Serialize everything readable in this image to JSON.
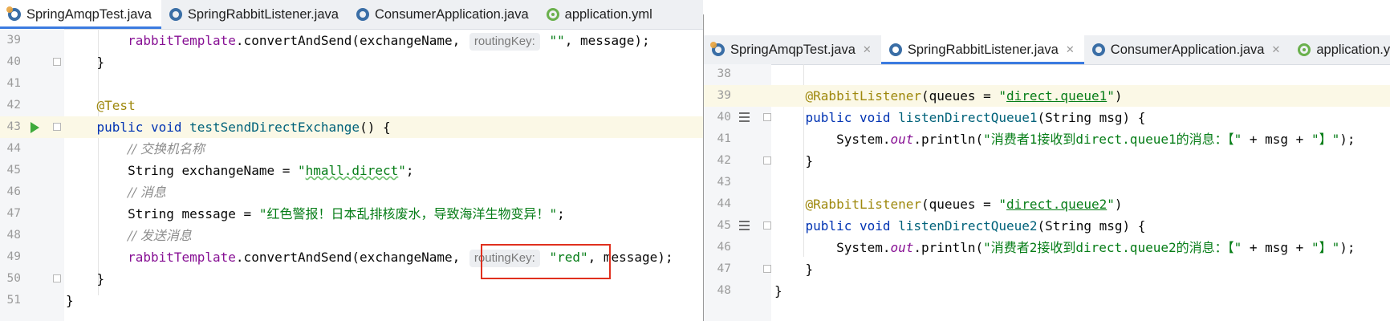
{
  "left": {
    "tabs": [
      {
        "label": "SpringAmqpTest.java",
        "icon": "java-class-icon",
        "active": true
      },
      {
        "label": "SpringRabbitListener.java",
        "icon": "java-class-icon",
        "active": false
      },
      {
        "label": "ConsumerApplication.java",
        "icon": "java-class-icon",
        "active": false
      },
      {
        "label": "application.yml",
        "icon": "spring-config-icon",
        "active": false
      }
    ],
    "line_numbers": [
      "39",
      "40",
      "41",
      "42",
      "43",
      "44",
      "45",
      "46",
      "47",
      "48",
      "49",
      "50",
      "51"
    ],
    "code": {
      "l39_a": "rabbitTemplate",
      "l39_b": ".convertAndSend(exchangeName, ",
      "l39_hint": "routingKey:",
      "l39_str": "\"\"",
      "l39_c": ", message);",
      "l40": "}",
      "l42": "@Test",
      "l43_kw1": "public",
      "l43_kw2": "void",
      "l43_m": "testSendDirectExchange",
      "l43_rest": "() {",
      "l44": "// 交换机名称",
      "l45_a": "String exchangeName = ",
      "l45_q1": "\"",
      "l45_str": "hmall.direct",
      "l45_q2": "\"",
      "l45_c": ";",
      "l46": "// 消息",
      "l47_a": "String message = ",
      "l47_str": "\"红色警报！日本乱排核废水，导致海洋生物变异！\"",
      "l47_c": ";",
      "l48": "// 发送消息",
      "l49_a": "rabbitTemplate",
      "l49_b": ".convertAndSend(exchangeName, ",
      "l49_hint": "routingKey:",
      "l49_str": "\"red\"",
      "l49_c": ", message);",
      "l50": "}",
      "l51": "}"
    }
  },
  "right": {
    "tabs": [
      {
        "label": "SpringAmqpTest.java",
        "icon": "java-class-icon",
        "active": false
      },
      {
        "label": "SpringRabbitListener.java",
        "icon": "java-class-icon",
        "active": true
      },
      {
        "label": "ConsumerApplication.java",
        "icon": "java-class-icon",
        "active": false
      },
      {
        "label": "application.yml",
        "icon": "spring-config-icon",
        "active": false
      }
    ],
    "line_numbers": [
      "38",
      "39",
      "40",
      "41",
      "42",
      "43",
      "44",
      "45",
      "46",
      "47",
      "48"
    ],
    "code": {
      "l39_ann": "@RabbitListener",
      "l39_a": "(queues = ",
      "l39_q1": "\"",
      "l39_str": "direct.queue1",
      "l39_q2": "\"",
      "l39_c": ")",
      "l40_kw1": "public",
      "l40_kw2": "void",
      "l40_m": "listenDirectQueue1",
      "l40_rest": "(String msg) {",
      "l41_a": "System.",
      "l41_out": "out",
      "l41_b": ".println(",
      "l41_str1": "\"消费者1接收到direct.queue1的消息：【\"",
      "l41_c": " + msg + ",
      "l41_str2": "\"】\"",
      "l41_d": ");",
      "l42": "}",
      "l44_ann": "@RabbitListener",
      "l44_a": "(queues = ",
      "l44_q1": "\"",
      "l44_str": "direct.queue2",
      "l44_q2": "\"",
      "l44_c": ")",
      "l45_kw1": "public",
      "l45_kw2": "void",
      "l45_m": "listenDirectQueue2",
      "l45_rest": "(String msg) {",
      "l46_a": "System.",
      "l46_out": "out",
      "l46_b": ".println(",
      "l46_str1": "\"消费者2接收到direct.queue2的消息：【\"",
      "l46_c": " + msg + ",
      "l46_str2": "\"】\"",
      "l46_d": ");",
      "l47": "}",
      "l48": "}"
    }
  },
  "colors": {
    "keyword": "#0033b3",
    "annotation": "#9e880d",
    "string": "#067d17",
    "comment": "#8c8c8c",
    "method": "#00627a",
    "field": "#871094",
    "highlight_box": "#e0301e",
    "active_tab_underline": "#3b7be0"
  }
}
